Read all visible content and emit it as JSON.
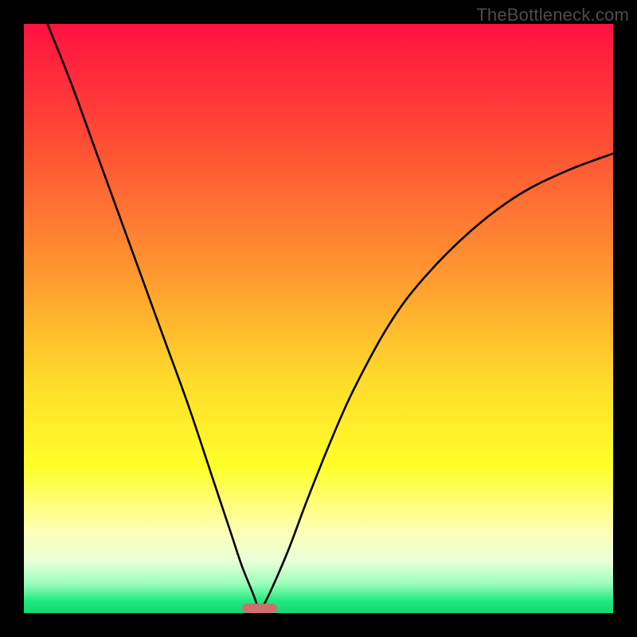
{
  "watermark": "TheBottleneck.com",
  "colors": {
    "frame": "#000000",
    "curve": "#000000",
    "marker": "#cc6f6d",
    "gradient_stops": [
      {
        "pct": 0,
        "color": "#ff1140"
      },
      {
        "pct": 20,
        "color": "#ff4d35"
      },
      {
        "pct": 42,
        "color": "#ff9730"
      },
      {
        "pct": 60,
        "color": "#ffd92b"
      },
      {
        "pct": 75,
        "color": "#ffff29"
      },
      {
        "pct": 86,
        "color": "#fdffb4"
      },
      {
        "pct": 91,
        "color": "#ecffd9"
      },
      {
        "pct": 95,
        "color": "#9cffbb"
      },
      {
        "pct": 98,
        "color": "#1fe87e"
      },
      {
        "pct": 100,
        "color": "#14d873"
      }
    ]
  },
  "chart_data": {
    "type": "line",
    "title": "",
    "xlabel": "",
    "ylabel": "",
    "xlim": [
      0,
      100
    ],
    "ylim": [
      0,
      100
    ],
    "note": "Two curves descending to a common minimum at x≈40, y≈0; left branch starts near top-left, right branch rises toward upper-right.",
    "series": [
      {
        "name": "left-branch",
        "x": [
          4,
          8,
          12,
          16,
          20,
          24,
          28,
          32,
          35,
          37,
          39,
          40
        ],
        "y": [
          100,
          90,
          79,
          68,
          57,
          46,
          35,
          23,
          14,
          8,
          3,
          0
        ]
      },
      {
        "name": "right-branch",
        "x": [
          40,
          42,
          45,
          48,
          52,
          56,
          62,
          68,
          76,
          84,
          92,
          100
        ],
        "y": [
          0,
          4,
          11,
          19,
          29,
          38,
          49,
          57,
          65,
          71,
          75,
          78
        ]
      }
    ],
    "marker": {
      "x_center": 40,
      "y": 0,
      "width": 6,
      "height": 1.6
    }
  }
}
